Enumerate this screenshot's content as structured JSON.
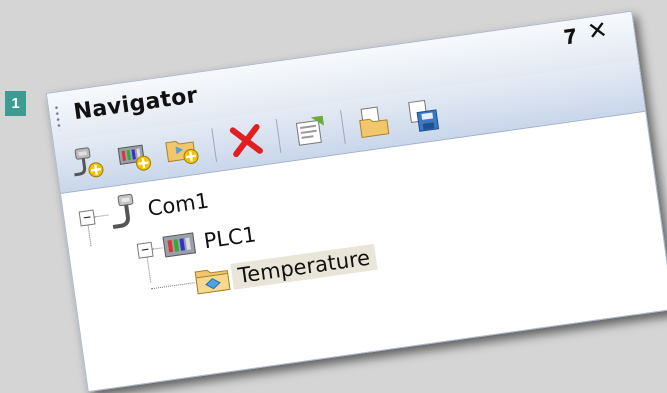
{
  "step_badge": "1",
  "window": {
    "title": "Navigator",
    "pin_icon": "pin-icon",
    "close_icon": "close-icon"
  },
  "toolbar": {
    "buttons": [
      {
        "name": "add-connection-button",
        "icon": "connection-plus-icon"
      },
      {
        "name": "add-plc-button",
        "icon": "plc-plus-icon"
      },
      {
        "name": "add-folder-button",
        "icon": "folder-plus-icon"
      },
      {
        "name": "delete-button",
        "icon": "red-x-icon"
      },
      {
        "name": "properties-button",
        "icon": "properties-icon"
      },
      {
        "name": "open-button",
        "icon": "open-folder-icon"
      },
      {
        "name": "save-button",
        "icon": "save-disk-icon"
      }
    ]
  },
  "tree": {
    "nodes": [
      {
        "label": "Com1",
        "icon": "connection-icon",
        "expanded": true
      },
      {
        "label": "PLC1",
        "icon": "plc-icon",
        "expanded": true
      },
      {
        "label": "Temperature",
        "icon": "folder-icon",
        "selected": true
      }
    ]
  }
}
